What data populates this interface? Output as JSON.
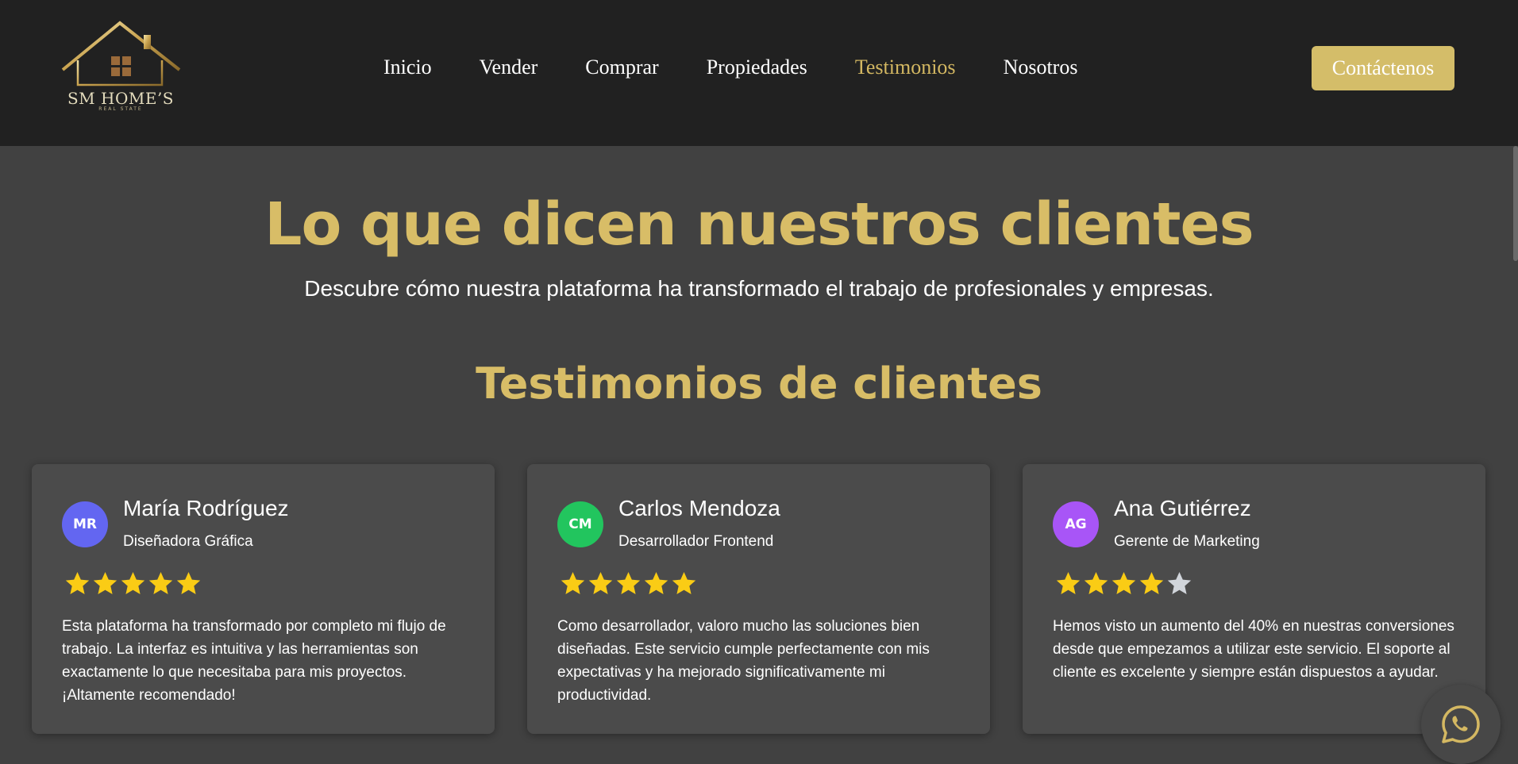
{
  "brand": {
    "name": "SM HOME’S",
    "tagline": "REAL STATE",
    "gold": "#d4b862"
  },
  "nav": {
    "items": [
      {
        "label": "Inicio",
        "active": false
      },
      {
        "label": "Vender",
        "active": false
      },
      {
        "label": "Comprar",
        "active": false
      },
      {
        "label": "Propiedades",
        "active": false
      },
      {
        "label": "Testimonios",
        "active": true
      },
      {
        "label": "Nosotros",
        "active": false
      }
    ],
    "contact_label": "Contáctenos"
  },
  "hero": {
    "title": "Lo que dicen nuestros clientes",
    "subtitle": "Descubre cómo nuestra plataforma ha transformado el trabajo de profesionales y empresas."
  },
  "section": {
    "title": "Testimonios de clientes"
  },
  "testimonials": [
    {
      "initials": "MR",
      "avatar_color": "#6366f1",
      "name": "María Rodríguez",
      "role": "Diseñadora Gráfica",
      "rating": 5,
      "text": "Esta plataforma ha transformado por completo mi flujo de trabajo. La interfaz es intuitiva y las herramientas son exactamente lo que necesitaba para mis proyectos. ¡Altamente recomendado!"
    },
    {
      "initials": "CM",
      "avatar_color": "#22c55e",
      "name": "Carlos Mendoza",
      "role": "Desarrollador Frontend",
      "rating": 5,
      "text": "Como desarrollador, valoro mucho las soluciones bien diseñadas. Este servicio cumple perfectamente con mis expectativas y ha mejorado significativamente mi productividad."
    },
    {
      "initials": "AG",
      "avatar_color": "#a855f7",
      "name": "Ana Gutiérrez",
      "role": "Gerente de Marketing",
      "rating": 4,
      "text": "Hemos visto un aumento del 40% en nuestras conversiones desde que empezamos a utilizar este servicio. El soporte al cliente es excelente y siempre están dispuestos a ayudar."
    }
  ],
  "colors": {
    "star_filled": "#facc15",
    "star_empty": "#d1d5db",
    "header_bg": "#212121",
    "page_bg": "#414141",
    "card_bg": "#4b4b4b"
  },
  "icons": {
    "whatsapp": "whatsapp-icon",
    "logo": "house-logo-icon"
  }
}
